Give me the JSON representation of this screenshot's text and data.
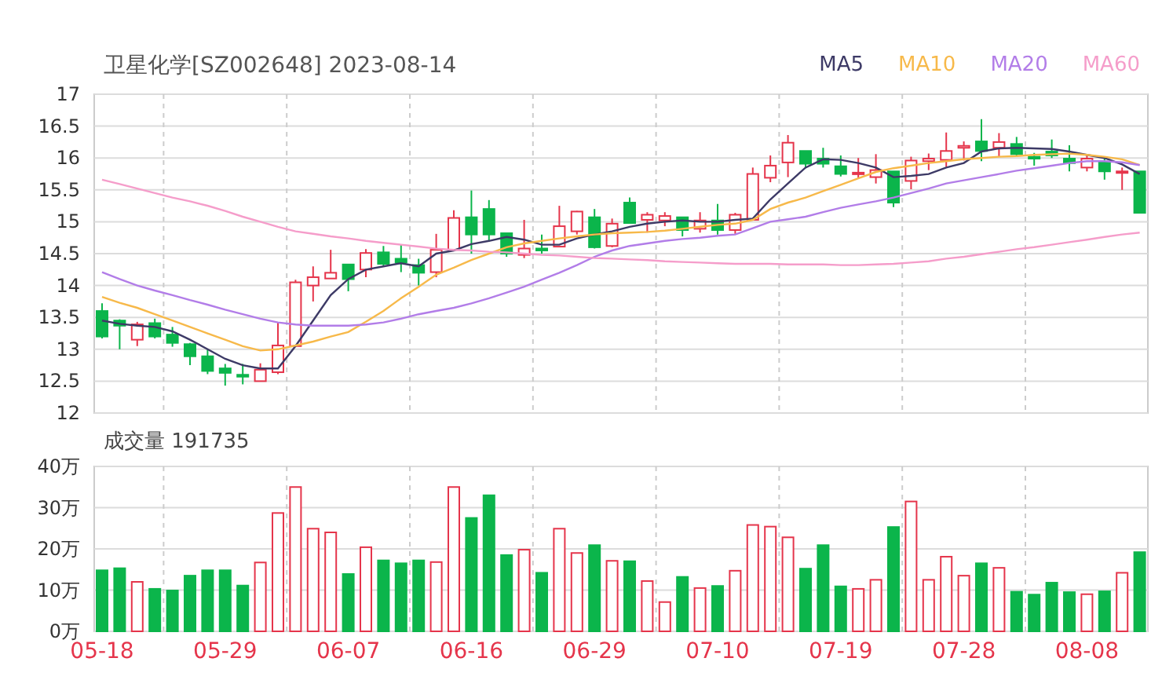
{
  "price_chart": {
    "chart_data": {
      "type": "candlestick",
      "title": "卫星化学[SZ002648] 2023-08-14",
      "grid": true,
      "ylim": [
        12,
        17
      ],
      "yticks": [
        17,
        16.5,
        16,
        15.5,
        15,
        14.5,
        14,
        13.5,
        13,
        12.5,
        12
      ],
      "ohlc": [
        [
          13.6,
          13.72,
          13.17,
          13.2
        ],
        [
          13.45,
          13.47,
          13.0,
          13.37
        ],
        [
          13.15,
          13.43,
          13.05,
          13.39
        ],
        [
          13.41,
          13.48,
          13.17,
          13.2
        ],
        [
          13.23,
          13.35,
          13.04,
          13.1
        ],
        [
          13.08,
          13.1,
          12.75,
          12.89
        ],
        [
          12.89,
          13.0,
          12.61,
          12.66
        ],
        [
          12.7,
          12.77,
          12.43,
          12.63
        ],
        [
          12.6,
          12.77,
          12.45,
          12.57
        ],
        [
          12.5,
          12.78,
          12.5,
          12.68
        ],
        [
          12.64,
          13.42,
          12.61,
          13.06
        ],
        [
          13.05,
          14.09,
          13.05,
          14.05
        ],
        [
          14.0,
          14.3,
          13.75,
          14.13
        ],
        [
          14.11,
          14.56,
          14.11,
          14.2
        ],
        [
          14.33,
          14.34,
          13.91,
          14.1
        ],
        [
          14.25,
          14.57,
          14.13,
          14.51
        ],
        [
          14.52,
          14.62,
          14.3,
          14.34
        ],
        [
          14.42,
          14.64,
          14.21,
          14.36
        ],
        [
          14.32,
          14.42,
          14.0,
          14.2
        ],
        [
          14.21,
          14.81,
          14.13,
          14.56
        ],
        [
          14.56,
          15.18,
          14.56,
          15.06
        ],
        [
          15.07,
          15.49,
          14.5,
          14.8
        ],
        [
          15.2,
          15.34,
          14.69,
          14.8
        ],
        [
          14.82,
          14.82,
          14.45,
          14.5
        ],
        [
          14.48,
          15.03,
          14.43,
          14.58
        ],
        [
          14.58,
          14.8,
          14.5,
          14.55
        ],
        [
          14.61,
          15.25,
          14.61,
          14.93
        ],
        [
          14.85,
          15.17,
          14.8,
          15.16
        ],
        [
          15.07,
          15.2,
          14.58,
          14.6
        ],
        [
          14.62,
          15.05,
          14.6,
          14.97
        ],
        [
          15.3,
          15.38,
          14.98,
          14.98
        ],
        [
          15.03,
          15.15,
          14.83,
          15.11
        ],
        [
          15.02,
          15.15,
          14.93,
          15.09
        ],
        [
          15.07,
          15.07,
          14.77,
          14.87
        ],
        [
          14.89,
          15.15,
          14.83,
          15.02
        ],
        [
          15.02,
          15.28,
          14.8,
          14.87
        ],
        [
          14.87,
          15.14,
          14.81,
          15.11
        ],
        [
          15.03,
          15.85,
          15.03,
          15.75
        ],
        [
          15.69,
          16.04,
          15.62,
          15.88
        ],
        [
          15.93,
          16.36,
          15.7,
          16.24
        ],
        [
          16.11,
          16.11,
          15.84,
          15.91
        ],
        [
          15.99,
          16.16,
          15.85,
          15.91
        ],
        [
          15.87,
          16.04,
          15.71,
          15.75
        ],
        [
          15.75,
          16.0,
          15.69,
          15.77
        ],
        [
          15.7,
          16.06,
          15.6,
          15.81
        ],
        [
          15.79,
          15.79,
          15.23,
          15.3
        ],
        [
          15.64,
          16.02,
          15.51,
          15.96
        ],
        [
          15.95,
          16.07,
          15.81,
          15.99
        ],
        [
          15.97,
          16.4,
          15.86,
          16.11
        ],
        [
          16.16,
          16.26,
          15.96,
          16.19
        ],
        [
          16.26,
          16.61,
          15.95,
          16.11
        ],
        [
          16.16,
          16.39,
          16.02,
          16.25
        ],
        [
          16.22,
          16.33,
          16.02,
          16.06
        ],
        [
          16.02,
          16.08,
          15.88,
          15.99
        ],
        [
          16.1,
          16.29,
          16.0,
          16.04
        ],
        [
          15.99,
          16.2,
          15.79,
          15.92
        ],
        [
          15.85,
          16.06,
          15.79,
          15.99
        ],
        [
          15.93,
          15.99,
          15.66,
          15.79
        ],
        [
          15.77,
          15.85,
          15.5,
          15.79
        ],
        [
          15.79,
          15.79,
          15.14,
          15.14
        ]
      ]
    }
  },
  "ma_chart": {
    "chart_data": {
      "type": "line",
      "ylim": [
        12,
        17
      ],
      "series": [
        {
          "name": "MA5",
          "color": "#3d3a66",
          "values": [
            13.45,
            13.4,
            13.37,
            13.35,
            13.28,
            13.15,
            13.0,
            12.85,
            12.75,
            12.7,
            12.7,
            13.05,
            13.45,
            13.85,
            14.1,
            14.25,
            14.3,
            14.35,
            14.3,
            14.5,
            14.55,
            14.65,
            14.7,
            14.76,
            14.72,
            14.64,
            14.64,
            14.74,
            14.8,
            14.85,
            14.92,
            14.97,
            15.0,
            15.02,
            15.0,
            15.0,
            15.03,
            15.05,
            15.35,
            15.6,
            15.85,
            15.98,
            15.97,
            15.92,
            15.85,
            15.7,
            15.72,
            15.75,
            15.85,
            15.92,
            16.1,
            16.15,
            16.16,
            16.15,
            16.14,
            16.1,
            16.05,
            16.0,
            15.9,
            15.75
          ]
        },
        {
          "name": "MA10",
          "color": "#f7b94a",
          "values": [
            13.82,
            13.73,
            13.65,
            13.55,
            13.45,
            13.35,
            13.25,
            13.15,
            13.05,
            12.98,
            13.0,
            13.06,
            13.12,
            13.2,
            13.27,
            13.43,
            13.6,
            13.8,
            13.98,
            14.17,
            14.28,
            14.4,
            14.5,
            14.6,
            14.66,
            14.7,
            14.74,
            14.77,
            14.8,
            14.82,
            14.83,
            14.84,
            14.86,
            14.89,
            14.92,
            14.95,
            14.97,
            15.03,
            15.2,
            15.3,
            15.38,
            15.48,
            15.58,
            15.68,
            15.78,
            15.84,
            15.88,
            15.92,
            15.95,
            15.98,
            16.0,
            16.02,
            16.03,
            16.05,
            16.06,
            16.07,
            16.05,
            16.02,
            15.98,
            15.89
          ]
        },
        {
          "name": "MA20",
          "color": "#b27de8",
          "values": [
            14.21,
            14.1,
            14.0,
            13.92,
            13.85,
            13.77,
            13.7,
            13.62,
            13.55,
            13.48,
            13.42,
            13.39,
            13.37,
            13.37,
            13.37,
            13.39,
            13.42,
            13.48,
            13.55,
            13.6,
            13.65,
            13.72,
            13.8,
            13.89,
            13.98,
            14.09,
            14.2,
            14.32,
            14.45,
            14.55,
            14.62,
            14.66,
            14.7,
            14.73,
            14.75,
            14.78,
            14.8,
            14.9,
            15.0,
            15.04,
            15.08,
            15.15,
            15.22,
            15.27,
            15.32,
            15.38,
            15.45,
            15.52,
            15.6,
            15.65,
            15.7,
            15.75,
            15.8,
            15.84,
            15.88,
            15.92,
            15.95,
            15.95,
            15.93,
            15.89
          ]
        },
        {
          "name": "MA60",
          "color": "#f59dca",
          "values": [
            15.66,
            15.59,
            15.52,
            15.45,
            15.38,
            15.32,
            15.25,
            15.17,
            15.08,
            15.0,
            14.92,
            14.85,
            14.81,
            14.77,
            14.74,
            14.7,
            14.67,
            14.64,
            14.61,
            14.58,
            14.56,
            14.55,
            14.53,
            14.52,
            14.5,
            14.48,
            14.47,
            14.45,
            14.43,
            14.42,
            14.41,
            14.4,
            14.38,
            14.37,
            14.36,
            14.35,
            14.34,
            14.34,
            14.34,
            14.33,
            14.33,
            14.33,
            14.32,
            14.32,
            14.33,
            14.34,
            14.36,
            14.38,
            14.42,
            14.45,
            14.49,
            14.53,
            14.57,
            14.6,
            14.64,
            14.68,
            14.72,
            14.76,
            14.8,
            14.83
          ]
        }
      ]
    }
  },
  "volume_chart": {
    "chart_data": {
      "type": "bar",
      "title": "成交量 191735",
      "grid": true,
      "categories": [
        "05-18",
        null,
        null,
        null,
        null,
        null,
        null,
        "05-29",
        null,
        null,
        null,
        null,
        null,
        null,
        "06-07",
        null,
        null,
        null,
        null,
        null,
        null,
        "06-16",
        null,
        null,
        null,
        null,
        null,
        null,
        "06-29",
        null,
        null,
        null,
        null,
        null,
        null,
        "07-10",
        null,
        null,
        null,
        null,
        null,
        null,
        "07-19",
        null,
        null,
        null,
        null,
        null,
        null,
        "07-28",
        null,
        null,
        null,
        null,
        null,
        null,
        "08-08",
        null,
        null,
        null
      ],
      "ylim": [
        0,
        40
      ],
      "yticks": [
        {
          "value": 40,
          "label": "40万"
        },
        {
          "value": 30,
          "label": "30万"
        },
        {
          "value": 20,
          "label": "20万"
        },
        {
          "value": 10,
          "label": "10万"
        },
        {
          "value": 0,
          "label": "0万"
        }
      ],
      "values": [
        14.8,
        15.3,
        12,
        10.3,
        9.9,
        13.5,
        14.8,
        14.8,
        11.1,
        16.7,
        28.7,
        35,
        24.9,
        24,
        13.9,
        20.4,
        17.2,
        16.5,
        17.2,
        16.8,
        35,
        27.5,
        33,
        18.5,
        19.8,
        14.2,
        24.9,
        19,
        20.9,
        17.1,
        17,
        12.2,
        7.1,
        13.2,
        10.5,
        11,
        14.7,
        25.8,
        25.4,
        22.8,
        15.2,
        20.9,
        10.9,
        10.3,
        12.5,
        25.3,
        31.5,
        12.5,
        18.1,
        13.5,
        16.5,
        15.4,
        9.6,
        8.9,
        11.8,
        9.5,
        9,
        9.7,
        14.2,
        19.2
      ]
    }
  }
}
